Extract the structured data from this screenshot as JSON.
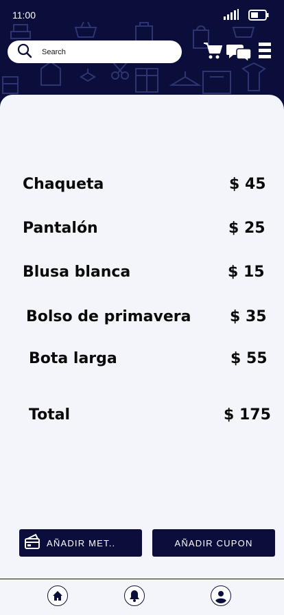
{
  "status_bar": {
    "time": "11:00"
  },
  "search": {
    "placeholder": "Search"
  },
  "header_icons": [
    "cart-icon",
    "chat-icon",
    "menu-icon"
  ],
  "items": [
    {
      "name": "Chaqueta",
      "price": "$ 45"
    },
    {
      "name": "Pantalón",
      "price": "$ 25"
    },
    {
      "name": "Blusa blanca",
      "price": "$ 15"
    },
    {
      "name": "Bolso de primavera",
      "price": "$ 35"
    },
    {
      "name": "Bota larga",
      "price": "$ 55"
    }
  ],
  "total": {
    "label": "Total",
    "value": "$ 175"
  },
  "buttons": {
    "payment": "AÑADIR  MET..",
    "coupon": "AÑADIR CUPON"
  },
  "bottom_nav": [
    "home-icon",
    "bell-icon",
    "profile-icon"
  ],
  "colors": {
    "primary": "#0b0e3a",
    "background": "#f4f5fb",
    "text": "#0a0a0a"
  }
}
